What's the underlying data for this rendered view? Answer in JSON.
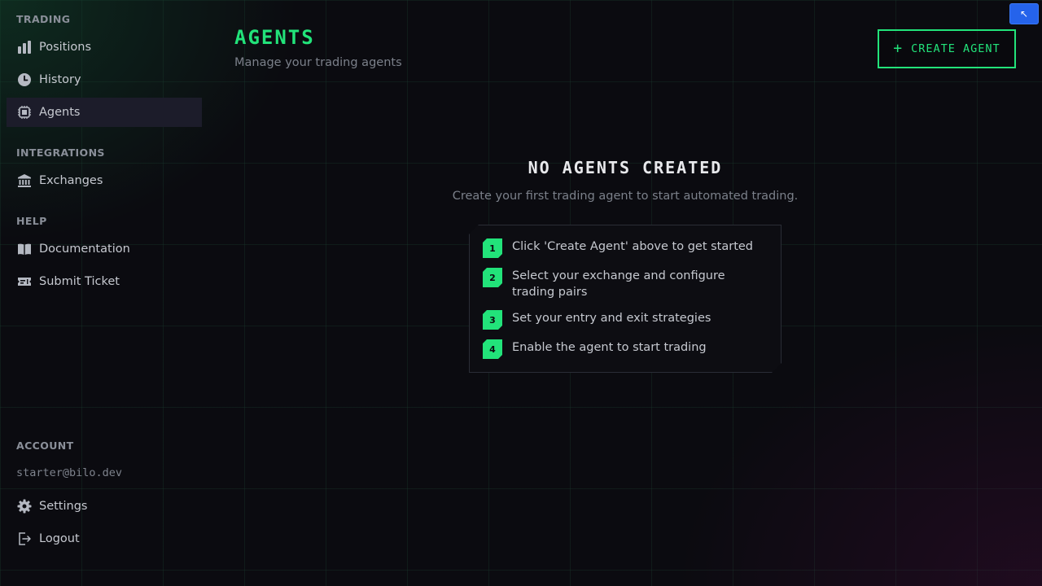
{
  "sidebar": {
    "sections": {
      "trading": "TRADING",
      "integrations": "INTEGRATIONS",
      "help": "HELP",
      "account": "ACCOUNT"
    },
    "items": {
      "positions": {
        "label": "Positions",
        "icon": "bar-chart-icon"
      },
      "history": {
        "label": "History",
        "icon": "clock-icon"
      },
      "agents": {
        "label": "Agents",
        "icon": "chip-icon",
        "active": true
      },
      "exchanges": {
        "label": "Exchanges",
        "icon": "bank-icon"
      },
      "documentation": {
        "label": "Documentation",
        "icon": "book-icon"
      },
      "submit_ticket": {
        "label": "Submit Ticket",
        "icon": "ticket-icon"
      },
      "settings": {
        "label": "Settings",
        "icon": "gear-icon"
      },
      "logout": {
        "label": "Logout",
        "icon": "logout-icon"
      }
    },
    "account_email": "starter@bilo.dev"
  },
  "header": {
    "title": "AGENTS",
    "subtitle": "Manage your trading agents",
    "create_button": "CREATE AGENT",
    "corner_button": "↖"
  },
  "empty_state": {
    "title": "NO AGENTS CREATED",
    "description": "Create your first trading agent to start automated trading.",
    "steps": [
      {
        "num": "1",
        "text": "Click 'Create Agent' above to get started"
      },
      {
        "num": "2",
        "text": "Select your exchange and configure trading pairs"
      },
      {
        "num": "3",
        "text": "Set your entry and exit strategies"
      },
      {
        "num": "4",
        "text": "Enable the agent to start trading"
      }
    ]
  },
  "colors": {
    "accent": "#22e37a",
    "background": "#0b0b10",
    "active_item": "#1c1c2a",
    "corner_button": "#2563eb"
  }
}
